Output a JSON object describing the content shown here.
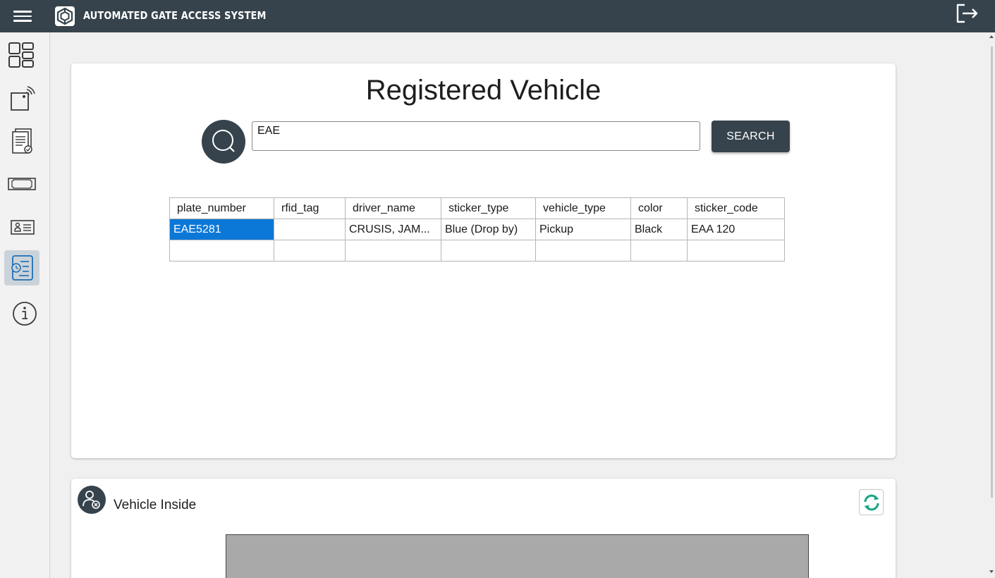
{
  "header": {
    "app_title": "AUTOMATED GATE ACCESS SYSTEM",
    "icons": [
      "menu-icon",
      "gate-logo-icon",
      "logout-icon"
    ],
    "background": "#36434c"
  },
  "sidebar": {
    "active_index": 5,
    "items": [
      {
        "icon": "dashboard-icon"
      },
      {
        "icon": "rfid-scanner-icon"
      },
      {
        "icon": "report-document-icon"
      },
      {
        "icon": "sticker-icon"
      },
      {
        "icon": "id-card-icon"
      },
      {
        "icon": "registered-vehicle-list-icon"
      },
      {
        "icon": "info-icon"
      }
    ]
  },
  "main": {
    "title": "Registered Vehicle",
    "search": {
      "value": "EAE",
      "button_label": "SEARCH"
    },
    "table": {
      "columns": [
        "plate_number",
        "rfid_tag",
        "driver_name",
        "sticker_type",
        "vehicle_type",
        "color",
        "sticker_code"
      ],
      "rows": [
        [
          "EAE5281",
          "",
          "CRUSIS, JAM...",
          "Blue (Drop by)",
          "Pickup",
          "Black",
          "EAA 120"
        ],
        [
          "",
          "",
          "",
          "",
          "",
          "",
          ""
        ]
      ],
      "selected_cell": "EAE5281"
    }
  },
  "vehicle_inside": {
    "title": "Vehicle Inside",
    "icons": [
      "vehicle-inside-icon",
      "refresh-icon"
    ]
  },
  "colors": {
    "primary": "#36434c",
    "selection": "#0b78d7",
    "refresh_accent": "#1aa587",
    "panel": "#a9a9a9"
  }
}
